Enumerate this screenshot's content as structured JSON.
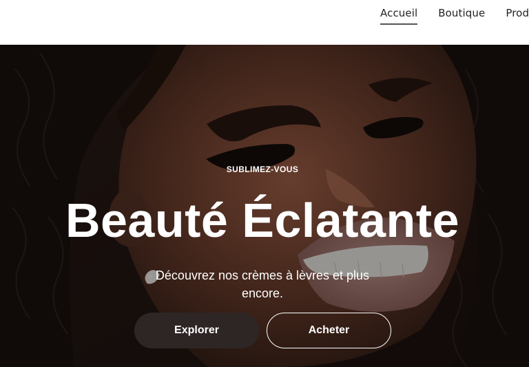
{
  "nav": {
    "items": [
      {
        "label": "Accueil",
        "active": true
      },
      {
        "label": "Boutique",
        "active": false
      },
      {
        "label": "Produ",
        "active": false
      }
    ]
  },
  "hero": {
    "kicker": "SUBLIMEZ-VOUS",
    "title": "Beauté Éclatante",
    "subtitle": "Découvrez nos crèmes à lèvres et plus encore.",
    "primary_button": "Explorer",
    "secondary_button": "Acheter",
    "image": "portrait-woman-smiling"
  },
  "colors": {
    "primary_button_bg": "#2d2624",
    "text_on_hero": "#ffffff",
    "nav_text": "#222222"
  }
}
